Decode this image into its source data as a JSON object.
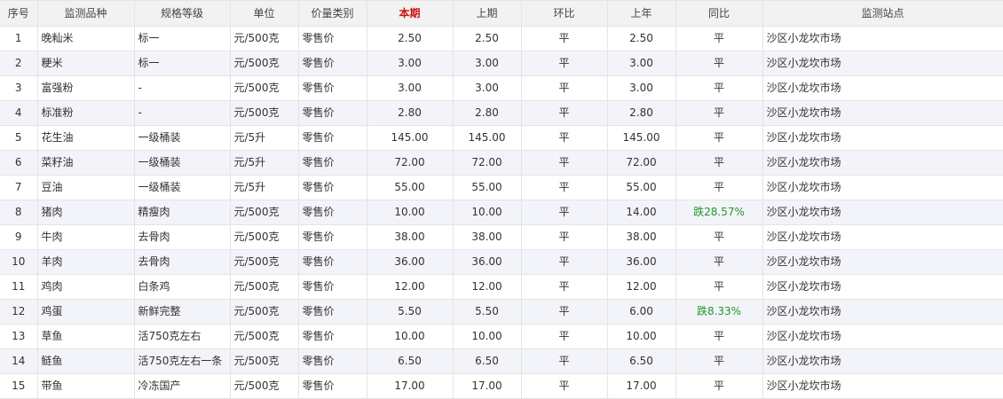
{
  "colors": {
    "current_header": "#cc1111",
    "change_down": "#229922",
    "row_alt": "#f3f3fa",
    "header_bg": "#f2f2f2"
  },
  "columns": [
    "序号",
    "监测品种",
    "规格等级",
    "单位",
    "价量类别",
    "本期",
    "上期",
    "环比",
    "上年",
    "同比",
    "监测站点"
  ],
  "rows": [
    {
      "no": "1",
      "item": "晚籼米",
      "spec": "标一",
      "unit": "元/500克",
      "type": "零售价",
      "current": "2.50",
      "previous": "2.50",
      "mom": "平",
      "last_year": "2.50",
      "yoy": "平",
      "site": "沙区小龙坎市场"
    },
    {
      "no": "2",
      "item": "粳米",
      "spec": "标一",
      "unit": "元/500克",
      "type": "零售价",
      "current": "3.00",
      "previous": "3.00",
      "mom": "平",
      "last_year": "3.00",
      "yoy": "平",
      "site": "沙区小龙坎市场"
    },
    {
      "no": "3",
      "item": "富强粉",
      "spec": "-",
      "unit": "元/500克",
      "type": "零售价",
      "current": "3.00",
      "previous": "3.00",
      "mom": "平",
      "last_year": "3.00",
      "yoy": "平",
      "site": "沙区小龙坎市场"
    },
    {
      "no": "4",
      "item": "标准粉",
      "spec": "-",
      "unit": "元/500克",
      "type": "零售价",
      "current": "2.80",
      "previous": "2.80",
      "mom": "平",
      "last_year": "2.80",
      "yoy": "平",
      "site": "沙区小龙坎市场"
    },
    {
      "no": "5",
      "item": "花生油",
      "spec": "一级桶装",
      "unit": "元/5升",
      "type": "零售价",
      "current": "145.00",
      "previous": "145.00",
      "mom": "平",
      "last_year": "145.00",
      "yoy": "平",
      "site": "沙区小龙坎市场"
    },
    {
      "no": "6",
      "item": "菜籽油",
      "spec": "一级桶装",
      "unit": "元/5升",
      "type": "零售价",
      "current": "72.00",
      "previous": "72.00",
      "mom": "平",
      "last_year": "72.00",
      "yoy": "平",
      "site": "沙区小龙坎市场"
    },
    {
      "no": "7",
      "item": "豆油",
      "spec": "一级桶装",
      "unit": "元/5升",
      "type": "零售价",
      "current": "55.00",
      "previous": "55.00",
      "mom": "平",
      "last_year": "55.00",
      "yoy": "平",
      "site": "沙区小龙坎市场"
    },
    {
      "no": "8",
      "item": "猪肉",
      "spec": "精瘦肉",
      "unit": "元/500克",
      "type": "零售价",
      "current": "10.00",
      "previous": "10.00",
      "mom": "平",
      "last_year": "14.00",
      "yoy": "跌28.57%",
      "site": "沙区小龙坎市场"
    },
    {
      "no": "9",
      "item": "牛肉",
      "spec": "去骨肉",
      "unit": "元/500克",
      "type": "零售价",
      "current": "38.00",
      "previous": "38.00",
      "mom": "平",
      "last_year": "38.00",
      "yoy": "平",
      "site": "沙区小龙坎市场"
    },
    {
      "no": "10",
      "item": "羊肉",
      "spec": "去骨肉",
      "unit": "元/500克",
      "type": "零售价",
      "current": "36.00",
      "previous": "36.00",
      "mom": "平",
      "last_year": "36.00",
      "yoy": "平",
      "site": "沙区小龙坎市场"
    },
    {
      "no": "11",
      "item": "鸡肉",
      "spec": "白条鸡",
      "unit": "元/500克",
      "type": "零售价",
      "current": "12.00",
      "previous": "12.00",
      "mom": "平",
      "last_year": "12.00",
      "yoy": "平",
      "site": "沙区小龙坎市场"
    },
    {
      "no": "12",
      "item": "鸡蛋",
      "spec": "新鲜完整",
      "unit": "元/500克",
      "type": "零售价",
      "current": "5.50",
      "previous": "5.50",
      "mom": "平",
      "last_year": "6.00",
      "yoy": "跌8.33%",
      "site": "沙区小龙坎市场"
    },
    {
      "no": "13",
      "item": "草鱼",
      "spec": "活750克左右",
      "unit": "元/500克",
      "type": "零售价",
      "current": "10.00",
      "previous": "10.00",
      "mom": "平",
      "last_year": "10.00",
      "yoy": "平",
      "site": "沙区小龙坎市场"
    },
    {
      "no": "14",
      "item": "鲢鱼",
      "spec": "活750克左右一条",
      "unit": "元/500克",
      "type": "零售价",
      "current": "6.50",
      "previous": "6.50",
      "mom": "平",
      "last_year": "6.50",
      "yoy": "平",
      "site": "沙区小龙坎市场"
    },
    {
      "no": "15",
      "item": "带鱼",
      "spec": "冷冻国产",
      "unit": "元/500克",
      "type": "零售价",
      "current": "17.00",
      "previous": "17.00",
      "mom": "平",
      "last_year": "17.00",
      "yoy": "平",
      "site": "沙区小龙坎市场"
    }
  ]
}
